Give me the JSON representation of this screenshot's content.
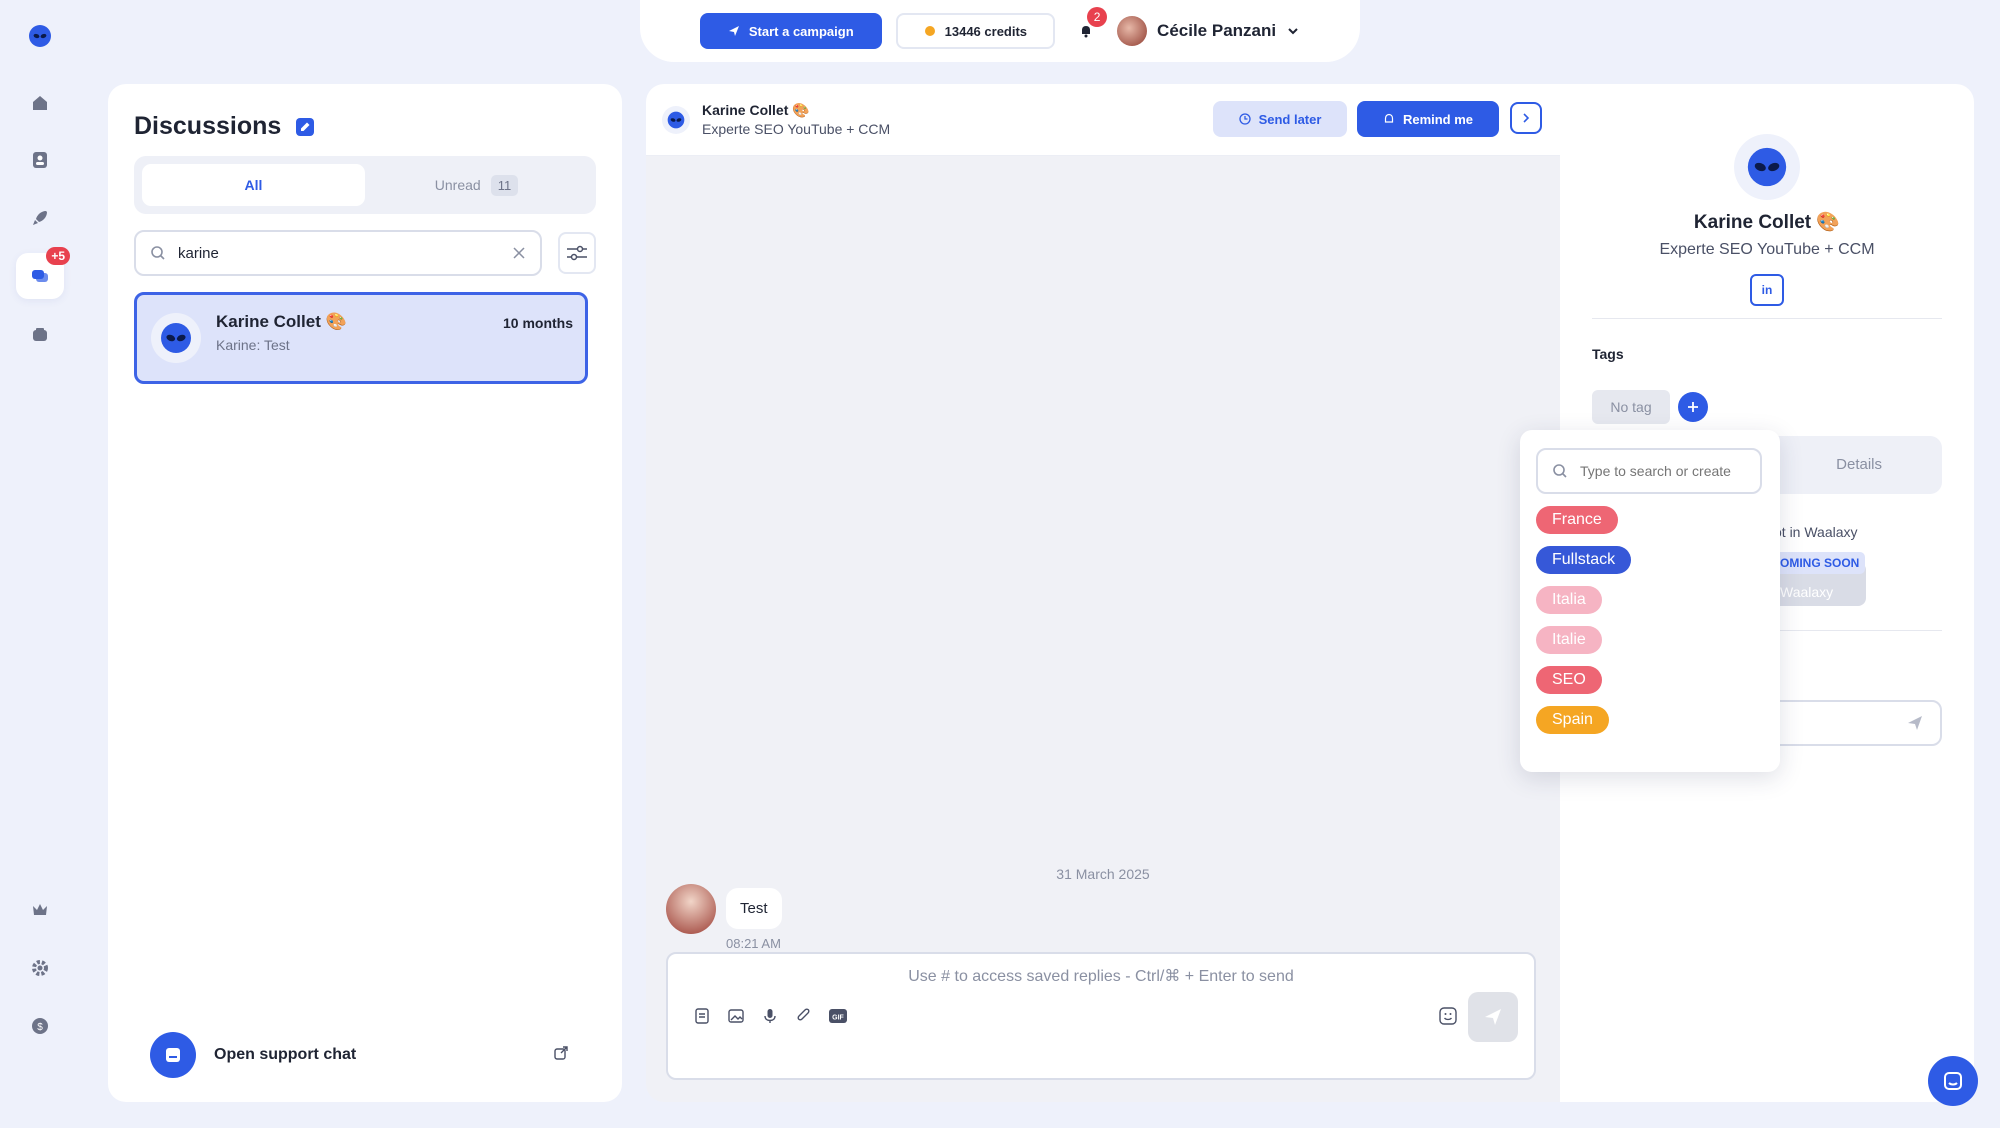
{
  "topbar": {
    "campaign_label": "Start a campaign",
    "credits_label": "13446 credits",
    "notifications_count": "2",
    "user_name": "Cécile Panzani"
  },
  "rail": {
    "messages_badge": "+5"
  },
  "discussions": {
    "title": "Discussions",
    "tabs": [
      {
        "label": "All"
      },
      {
        "label": "Unread",
        "count": "11"
      }
    ],
    "search_value": "karine",
    "conversations": [
      {
        "name": "Karine Collet 🎨",
        "preview": "Karine: Test",
        "time": "10 months"
      }
    ],
    "support_label": "Open support chat"
  },
  "chat": {
    "contact_name": "Karine Collet 🎨",
    "contact_title": "Experte SEO YouTube + CCM",
    "send_later_label": "Send later",
    "remind_label": "Remind me",
    "date_separator": "31 March 2025",
    "messages": [
      {
        "text": "Test",
        "time": "08:21 AM"
      }
    ],
    "composer_placeholder": "Use # to access saved replies - Ctrl/⌘ + Enter to send"
  },
  "profile": {
    "name": "Karine Collet 🎨",
    "title": "Experte SEO YouTube + CCM",
    "linkedin_label": "in",
    "tags_label": "Tags",
    "no_tag_label": "No tag",
    "details_tab": "Details",
    "not_in_text": "ot in Waalaxy",
    "coming_soon": "OMING SOON",
    "waalaxy_text": "Waalaxy"
  },
  "tag_dropdown": {
    "search_placeholder": "Type to search or create",
    "tags": [
      {
        "label": "France",
        "color": "#ee6674"
      },
      {
        "label": "Fullstack",
        "color": "#3658d8"
      },
      {
        "label": "Italia",
        "color": "#f6b4c3"
      },
      {
        "label": "Italie",
        "color": "#f6b4c3"
      },
      {
        "label": "SEO",
        "color": "#ee6674"
      },
      {
        "label": "Spain",
        "color": "#f5a623"
      }
    ]
  },
  "colors": {
    "accent": "#2e5be5",
    "background": "#eef1fb",
    "badge": "#e8414e"
  }
}
